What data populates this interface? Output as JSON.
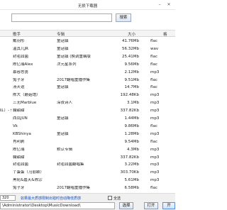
{
  "window": {
    "title": "无损下载器",
    "minimize": "–",
    "close": "✕"
  },
  "search": {
    "value": "",
    "button": "搜索"
  },
  "table": {
    "headers": {
      "name": "歌手",
      "album": "专辑",
      "size": "大小",
      "format": "格"
    },
    "rows": [
      {
        "left": "",
        "name": "戴羽彤",
        "album": "童话镇",
        "size": "41.76Mb",
        "format": "flac"
      },
      {
        "left": "",
        "name": "温其儿JR",
        "album": "童话镇",
        "size": "56.32Mb",
        "format": "wav"
      },
      {
        "left": "",
        "name": "封茗囧菌",
        "album": "童话镇 (换调重编版",
        "size": "25.41Mb",
        "format": "flac"
      },
      {
        "left": "",
        "name": "陈亿瑞Alex",
        "album": "次元星系列",
        "size": "9.56Mb",
        "format": "flac"
      },
      {
        "left": "",
        "name": "慕容思勇",
        "album": "",
        "size": "2.12Mb",
        "format": "mp3"
      },
      {
        "left": "",
        "name": "兔子牙",
        "album": "2017翻唱重播作集",
        "size": "9.51Mb",
        "format": "flac"
      },
      {
        "left": "",
        "name": "汤天谊",
        "album": "童话镇",
        "size": "14.7Mb",
        "format": "flac"
      },
      {
        "left": "",
        "name": "陈大（蘑菇炮）",
        "album": "",
        "size": "192.48Kb",
        "format": "mp3"
      },
      {
        "left": "",
        "name": "三无Marblue",
        "album": "深夜诗人",
        "size": "3.1Mb",
        "format": "mp3"
      },
      {
        "left": "",
        "name": "鞠甜甜",
        "album": "",
        "size": "337.82Kb",
        "format": "mp3"
      },
      {
        "left": "",
        "name": "西瓜JUN",
        "album": "童话镇",
        "size": "1.44Mb",
        "format": "mp3"
      },
      {
        "left": "",
        "name": "Vk",
        "album": "",
        "size": "9.86Mb",
        "format": "flac"
      },
      {
        "left": "",
        "name": "KBShinya",
        "album": "童话镇",
        "size": "1.28Mb",
        "format": "mp3"
      },
      {
        "left": "",
        "name": "肖利剥",
        "album": "",
        "size": "9.54Mb",
        "format": "flac"
      },
      {
        "left": "",
        "name": "陈亿瑞",
        "album": "默认专辑",
        "size": "4.3Mb",
        "format": "mp3"
      },
      {
        "left": "",
        "name": "鞠甜甜",
        "album": "",
        "size": "337.82Kb",
        "format": "mp3"
      },
      {
        "left": "",
        "name": "封茗囧菌",
        "album": "封茗囧菌翻唱集",
        "size": "3.22Mb",
        "format": "mp3"
      },
      {
        "left": "",
        "name": "丫蛋蛋（马丽颖）",
        "album": "",
        "size": "303.70Kb",
        "format": "mp3"
      },
      {
        "left": "",
        "name": "黑轮&嘉天&陈宗",
        "album": "",
        "size": "5.61Mb",
        "format": "mp3"
      },
      {
        "left": "",
        "name": "兔子牙",
        "album": "2017翻唱重播作集",
        "size": "6.58Mb",
        "format": "flac"
      }
    ],
    "left_fragments": [
      "",
      "",
      "",
      "",
      "",
      "",
      "",
      "",
      "",
      "红）- 付...",
      "",
      "",
      "",
      "",
      "",
      "",
      "",
      "",
      "",
      ""
    ]
  },
  "bottom": {
    "quality": "320",
    "note": "如果最大质感限制出错时自动降低质感",
    "checkbox_label": "全选",
    "path": "\\Administrator\\Desktop\\MusicDownload\\",
    "browse": "选择",
    "open": "打开",
    "start": "开"
  },
  "status": {
    "text": "下载进度：84% 下载速度：45.19MB/s 预计：0.00",
    "progress": 0.84
  }
}
